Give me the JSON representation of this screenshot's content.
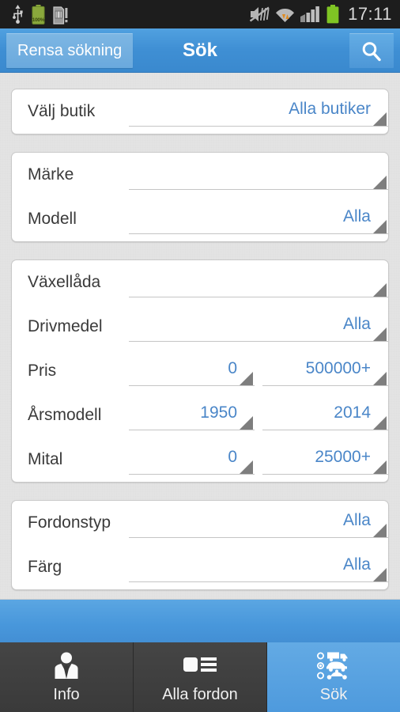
{
  "status_bar": {
    "left_icons": [
      "usb-icon",
      "battery-100-icon",
      "sdcard-icon"
    ],
    "right_icons": [
      "mute-icon",
      "wifi-icon",
      "cellular-signal-icon",
      "battery-icon"
    ],
    "battery_percent": "100%",
    "clock": "17:11"
  },
  "action_bar": {
    "clear_label": "Rensa sökning",
    "title": "Sök",
    "search_icon": "search-icon"
  },
  "colors": {
    "accent_blue": "#4a86c8",
    "actionbar_blue": "#3f8fd4",
    "value_blue": "#4a86c8",
    "background": "#e3e3e3",
    "nav_dark": "#3b3b3b",
    "triangle_gray": "#7e7e7e"
  },
  "cards": [
    {
      "name": "store-card",
      "rows": [
        {
          "label": "Välj butik",
          "spinners": [
            {
              "value": "Alla butiker"
            }
          ]
        }
      ]
    },
    {
      "name": "make-model-card",
      "rows": [
        {
          "label": "Märke",
          "spinners": [
            {
              "value": ""
            }
          ]
        },
        {
          "label": "Modell",
          "spinners": [
            {
              "value": "Alla"
            }
          ]
        }
      ]
    },
    {
      "name": "specs-card",
      "rows": [
        {
          "label": "Växellåda",
          "spinners": [
            {
              "value": ""
            }
          ]
        },
        {
          "label": "Drivmedel",
          "spinners": [
            {
              "value": "Alla"
            }
          ]
        },
        {
          "label": "Pris",
          "spinners": [
            {
              "value": "0"
            },
            {
              "value": "500000+"
            }
          ]
        },
        {
          "label": "Årsmodell",
          "spinners": [
            {
              "value": "1950"
            },
            {
              "value": "2014"
            }
          ]
        },
        {
          "label": "Mital",
          "spinners": [
            {
              "value": "0"
            },
            {
              "value": "25000+"
            }
          ]
        }
      ]
    },
    {
      "name": "type-color-card",
      "rows": [
        {
          "label": "Fordonstyp",
          "spinners": [
            {
              "value": "Alla"
            }
          ]
        },
        {
          "label": "Färg",
          "spinners": [
            {
              "value": "Alla"
            }
          ]
        }
      ]
    }
  ],
  "bottom_nav": {
    "items": [
      {
        "label": "Info",
        "icon": "person-suit-icon",
        "active": false
      },
      {
        "label": "Alla fordon",
        "icon": "list-thumbnail-icon",
        "active": false
      },
      {
        "label": "Sök",
        "icon": "vehicle-select-icon",
        "active": true
      }
    ]
  }
}
